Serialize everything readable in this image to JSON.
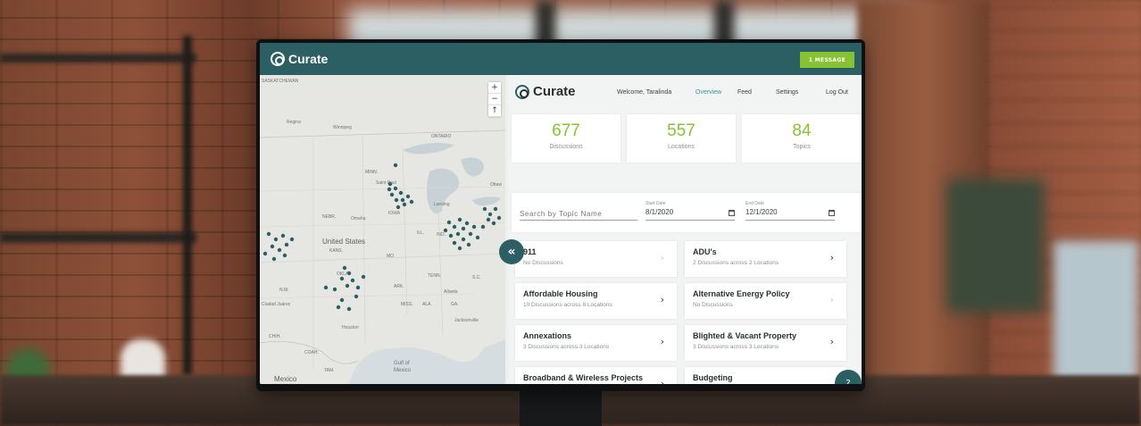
{
  "app": {
    "brand": "Curate",
    "message_button": "1 MESSAGE"
  },
  "map": {
    "labels": {
      "saskatchewan": "SASKATCHEWAN",
      "regina": "Regina",
      "winnipeg": "Winnipeg",
      "ontario": "ONTARIO",
      "minn": "MINN.",
      "saint_paul": "Saint Paul",
      "iowa": "IOWA",
      "omaha": "Omaha",
      "nebr": "NEBR.",
      "ill": "ILL.",
      "ind": "IND.",
      "lansing": "Lansing",
      "ottawa": "Ottaw",
      "united_states": "United States",
      "kans": "KANS.",
      "mo": "MO.",
      "tenn": "TENN.",
      "ark": "ARK.",
      "nm": "N.M.",
      "okla": "OKLA.",
      "miss": "MISS.",
      "ala": "ALA.",
      "ga": "GA.",
      "atlanta": "Atlanta",
      "sc": "S.C.",
      "ciudad_juarez": "Ciudad Juárez",
      "houston": "Houston",
      "jacksonville": "Jacksonville",
      "chih": "CHIH.",
      "coah": "COAH.",
      "mexico": "Mexico",
      "gulf": "Gulf of",
      "gulf2": "Mexico",
      "tam": "TAM."
    },
    "zoom_in": "+",
    "zoom_out": "−",
    "reset_north": "↑",
    "collapse": "«"
  },
  "nav": {
    "brand": "Curate",
    "welcome": "Welcome, Taralinda",
    "links": [
      "Overview",
      "Feed",
      "Settings",
      "Log Out"
    ]
  },
  "stats": [
    {
      "value": "677",
      "label": "Discussions"
    },
    {
      "value": "557",
      "label": "Locations"
    },
    {
      "value": "84",
      "label": "Topics"
    }
  ],
  "filters": {
    "search_placeholder": "Search by Topic Name",
    "start_label": "Start Date",
    "start_value": "8/1/2020",
    "end_label": "End Date",
    "end_value": "12/1/2020"
  },
  "topics": [
    {
      "title": "911",
      "subtitle": "No Discussions",
      "chevron": "›"
    },
    {
      "title": "ADU's",
      "subtitle": "2 Discussions across 2 Locations",
      "chevron": "›"
    },
    {
      "title": "Affordable Housing",
      "subtitle": "10 Discussions across 8 Locations",
      "chevron": "›"
    },
    {
      "title": "Alternative Energy Policy",
      "subtitle": "No Discussions",
      "chevron": "›"
    },
    {
      "title": "Annexations",
      "subtitle": "3 Discussions across 3 Locations",
      "chevron": "›"
    },
    {
      "title": "Blighted & Vacant Property",
      "subtitle": "3 Discussions across 3 Locations",
      "chevron": "›"
    },
    {
      "title": "Broadband & Wireless Projects",
      "subtitle": "",
      "chevron": "›"
    },
    {
      "title": "Budgeting",
      "subtitle": "",
      "chevron": "›"
    }
  ],
  "help_icon": "?",
  "colors": {
    "header": "#2c5f63",
    "accent_green": "#86c232",
    "nav_active": "#3c8fa0",
    "map_dot": "#2c5f63"
  }
}
